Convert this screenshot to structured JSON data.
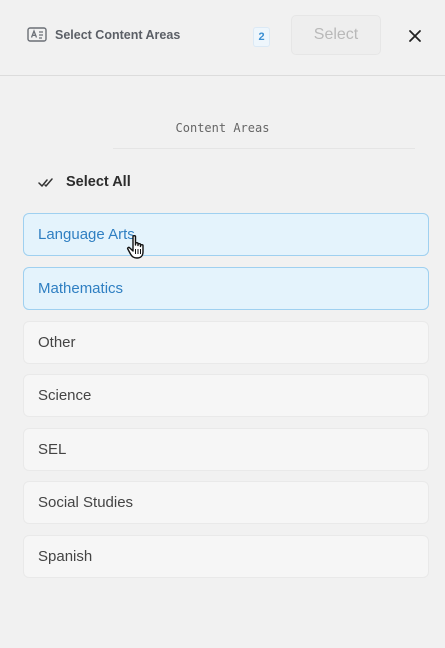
{
  "header": {
    "title": "Select Content Areas",
    "selected_count": "2",
    "select_label": "Select",
    "icon": "content-areas-icon",
    "close_icon": "close-icon"
  },
  "section": {
    "title": "Content Areas"
  },
  "select_all": {
    "label": "Select All"
  },
  "items": [
    {
      "label": "Language Arts",
      "selected": true
    },
    {
      "label": "Mathematics",
      "selected": true
    },
    {
      "label": "Other",
      "selected": false
    },
    {
      "label": "Science",
      "selected": false
    },
    {
      "label": "SEL",
      "selected": false
    },
    {
      "label": "Social Studies",
      "selected": false
    },
    {
      "label": "Spanish",
      "selected": false
    }
  ],
  "colors": {
    "selected_bg": "#e4f3fc",
    "selected_border": "#9fd0f0",
    "selected_text": "#2f7fc2",
    "badge_text": "#3a8fd3"
  }
}
